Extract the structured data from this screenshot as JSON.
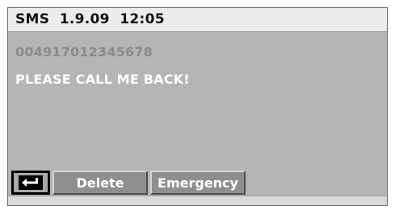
{
  "header": {
    "title": "SMS  1.9.09  12:05"
  },
  "message": {
    "sender": "004917012345678",
    "text": "PLEASE CALL ME BACK!"
  },
  "toolbar": {
    "back_icon": "return-arrow-icon",
    "delete_label": "Delete",
    "emergency_label": "Emergency"
  },
  "colors": {
    "screen_background": "#b5b5b5",
    "header_background": "#ececec",
    "button_background": "#8f8f8f",
    "sender_text": "#8a8a8a",
    "message_text": "#ffffff"
  }
}
